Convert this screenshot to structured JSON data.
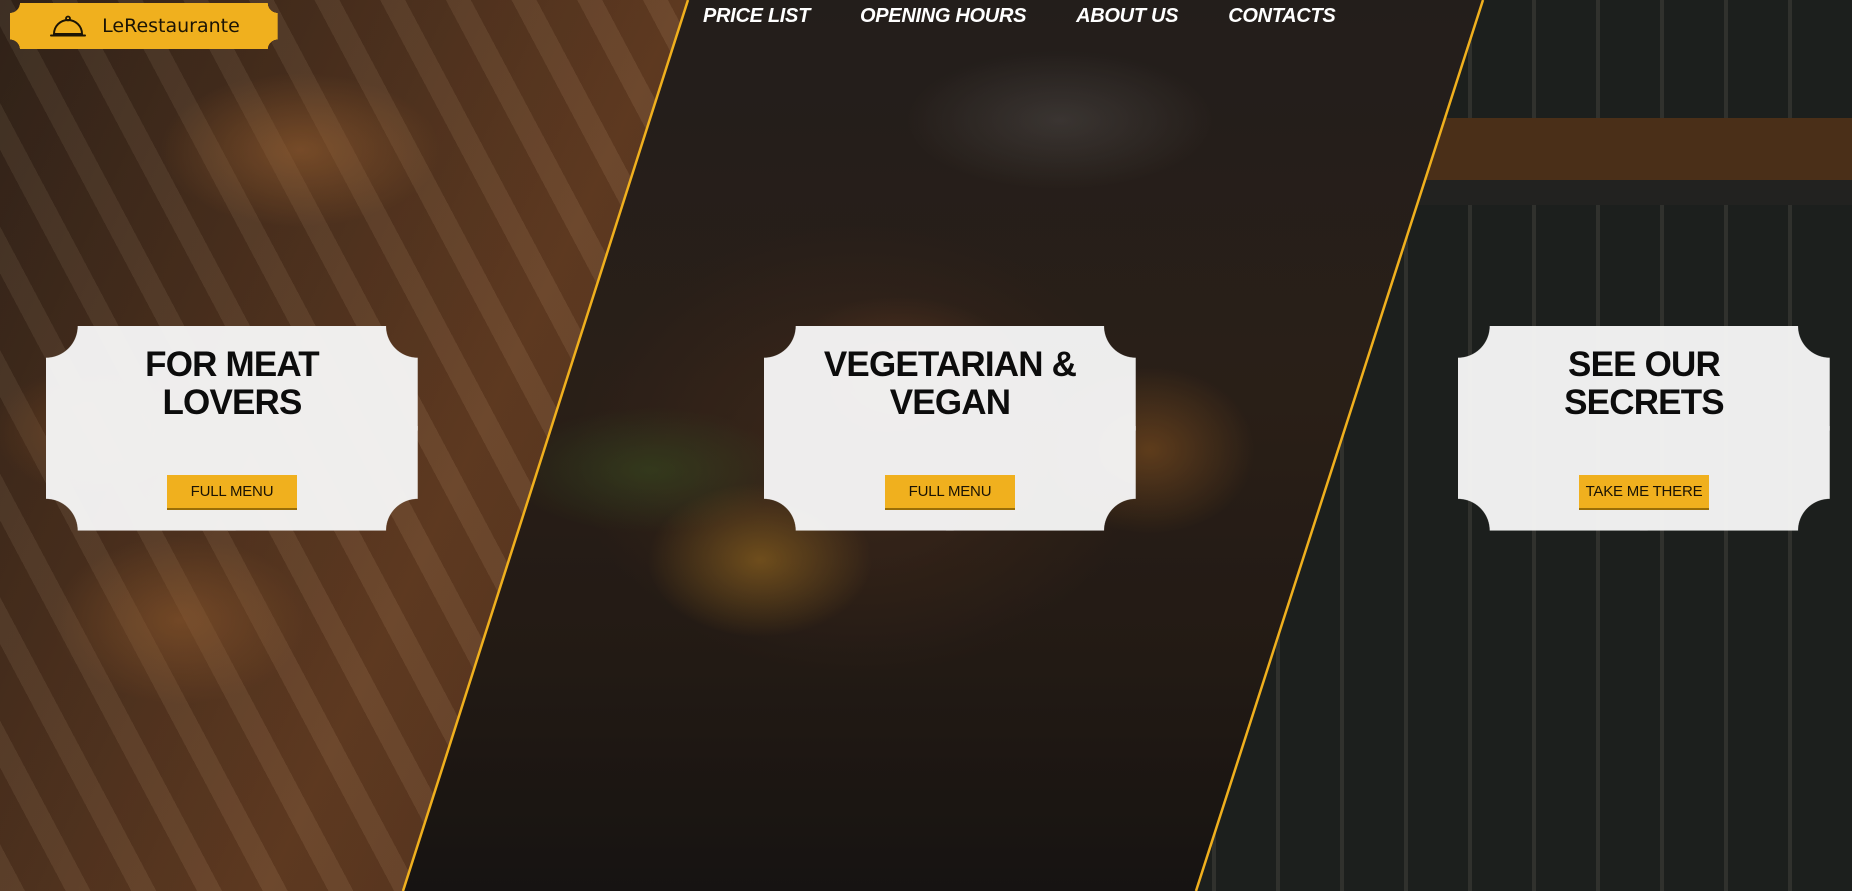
{
  "brand": {
    "name": "LeRestaurante",
    "icon": "cloche-icon",
    "color": "#f0b01e"
  },
  "nav": {
    "items": [
      {
        "label": "PRICE LIST"
      },
      {
        "label": "OPENING HOURS"
      },
      {
        "label": "ABOUT US"
      },
      {
        "label": "CONTACTS"
      }
    ]
  },
  "cards": [
    {
      "title": "FOR MEAT LOVERS",
      "button": "FULL MENU"
    },
    {
      "title": "VEGETARIAN & VEGAN",
      "button": "FULL MENU"
    },
    {
      "title": "SEE OUR SECRETS",
      "button": "TAKE ME THERE"
    }
  ],
  "colors": {
    "accent": "#f0b01e",
    "divider": "#f0b01e",
    "card": "#f6f6f6"
  }
}
